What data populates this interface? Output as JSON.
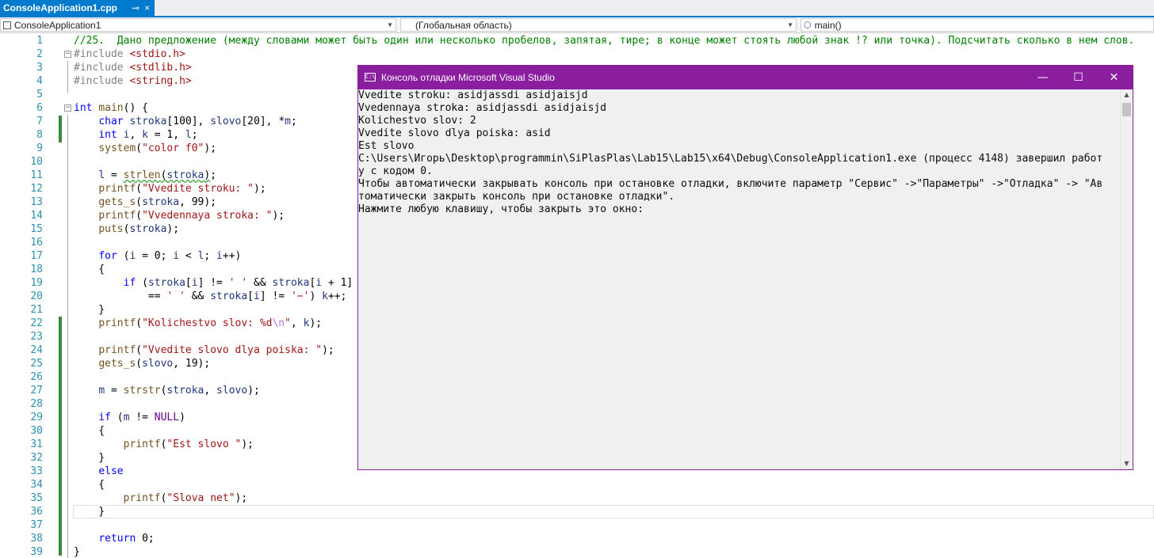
{
  "tab": {
    "filename": "ConsoleApplication1.cpp",
    "pin_icon": "⊸",
    "close_icon": "×"
  },
  "nav": {
    "project": "ConsoleApplication1",
    "scope": "(Глобальная область)",
    "member": "main()"
  },
  "code_lines": [
    {
      "n": "1",
      "html": "<span class='cm'>//25.  Дано предложение (между словами может быть один или несколько пробелов, запятая, тире; в конце может стоять любой знак !? или точка). Подсчитать сколько в нем слов.</span>"
    },
    {
      "n": "2",
      "html": "<span class='pp'>#include</span> <span class='str'>&lt;stdio.h&gt;</span>"
    },
    {
      "n": "3",
      "html": "<span class='pp'>#include</span> <span class='str'>&lt;stdlib.h&gt;</span>"
    },
    {
      "n": "4",
      "html": "<span class='pp'>#include</span> <span class='str'>&lt;string.h&gt;</span>"
    },
    {
      "n": "5",
      "html": ""
    },
    {
      "n": "6",
      "html": "<span class='kw'>int</span> <span class='fn'>main</span>() {"
    },
    {
      "n": "7",
      "html": "    <span class='kw'>char</span> <span class='var'>stroka</span>[100], <span class='var'>slovo</span>[20], *<span class='var'>m</span>;"
    },
    {
      "n": "8",
      "html": "    <span class='kw'>int</span> <span class='var'>i</span>, <span class='var'>k</span> = 1, <span class='var'>l</span>;"
    },
    {
      "n": "9",
      "html": "    <span class='fn'>system</span>(<span class='str'>\"color f0\"</span>);"
    },
    {
      "n": "10",
      "html": ""
    },
    {
      "n": "11",
      "html": "    <span class='var'>l</span> = <span class='squig'><span class='fn'>strlen</span>(<span class='var'>stroka</span>)</span>;"
    },
    {
      "n": "12",
      "html": "    <span class='fn'>printf</span>(<span class='str'>\"Vvedite stroku: \"</span>);"
    },
    {
      "n": "13",
      "html": "    <span class='fn'>gets_s</span>(<span class='var'>stroka</span>, 99);"
    },
    {
      "n": "14",
      "html": "    <span class='fn'>printf</span>(<span class='str'>\"Vvedennaya stroka: \"</span>);"
    },
    {
      "n": "15",
      "html": "    <span class='fn'>puts</span>(<span class='var'>stroka</span>);"
    },
    {
      "n": "16",
      "html": ""
    },
    {
      "n": "17",
      "html": "    <span class='kw'>for</span> (<span class='var'>i</span> = 0; <span class='var'>i</span> &lt; <span class='var'>l</span>; <span class='var'>i</span>++)"
    },
    {
      "n": "18",
      "html": "    {"
    },
    {
      "n": "19",
      "html": "        <span class='kw'>if</span> (<span class='var'>stroka</span>[<span class='var'>i</span>] != <span class='str'>' '</span> &amp;&amp; <span class='var'>stroka</span>[<span class='var'>i</span> + 1]"
    },
    {
      "n": "20",
      "html": "            == <span class='str'>' '</span> &amp;&amp; <span class='var'>stroka</span>[<span class='var'>i</span>] != <span class='str'>'−'</span>) <span class='var'>k</span>++;"
    },
    {
      "n": "21",
      "html": "    }"
    },
    {
      "n": "22",
      "html": "    <span class='fn'>printf</span>(<span class='str'>\"Kolichestvo slov: %d<span class='esc'>\\n</span>\"</span>, <span class='var'>k</span>);"
    },
    {
      "n": "23",
      "html": ""
    },
    {
      "n": "24",
      "html": "    <span class='fn'>printf</span>(<span class='str'>\"Vvedite slovo dlya poiska: \"</span>);"
    },
    {
      "n": "25",
      "html": "    <span class='fn'>gets_s</span>(<span class='var'>slovo</span>, 19);"
    },
    {
      "n": "26",
      "html": ""
    },
    {
      "n": "27",
      "html": "    <span class='var'>m</span> = <span class='fn'>strstr</span>(<span class='var'>stroka</span>, <span class='var'>slovo</span>);"
    },
    {
      "n": "28",
      "html": ""
    },
    {
      "n": "29",
      "html": "    <span class='kw'>if</span> (<span class='var'>m</span> != <span class='mac'>NULL</span>)"
    },
    {
      "n": "30",
      "html": "    {"
    },
    {
      "n": "31",
      "html": "        <span class='fn'>printf</span>(<span class='str'>\"Est slovo \"</span>);"
    },
    {
      "n": "32",
      "html": "    }"
    },
    {
      "n": "33",
      "html": "    <span class='kw'>else</span>"
    },
    {
      "n": "34",
      "html": "    {"
    },
    {
      "n": "35",
      "html": "        <span class='fn'>printf</span>(<span class='str'>\"Slova net\"</span>);"
    },
    {
      "n": "36",
      "html": "    }"
    },
    {
      "n": "37",
      "html": ""
    },
    {
      "n": "38",
      "html": "    <span class='kw'>return</span> 0;"
    },
    {
      "n": "39",
      "html": "}"
    }
  ],
  "console": {
    "title": "Консоль отладки Microsoft Visual Studio",
    "icon_text": "C:\\",
    "minimize": "—",
    "maximize": "☐",
    "close": "✕",
    "lines": [
      "Vvedite stroku: asidjassdi asidjaisjd",
      "Vvedennaya stroka: asidjassdi asidjaisjd",
      "Kolichestvo slov: 2",
      "Vvedite slovo dlya poiska: asid",
      "Est slovo",
      "C:\\Users\\Игорь\\Desktop\\programmin\\SiPlasPlas\\Lab15\\Lab15\\x64\\Debug\\ConsoleApplication1.exe (процесс 4148) завершил работ",
      "у с кодом 0.",
      "Чтобы автоматически закрывать консоль при остановке отладки, включите параметр \"Сервис\" ->\"Параметры\" ->\"Отладка\" -> \"Ав",
      "томатически закрыть консоль при остановке отладки\".",
      "Нажмите любую клавишу, чтобы закрыть это окно:"
    ]
  }
}
